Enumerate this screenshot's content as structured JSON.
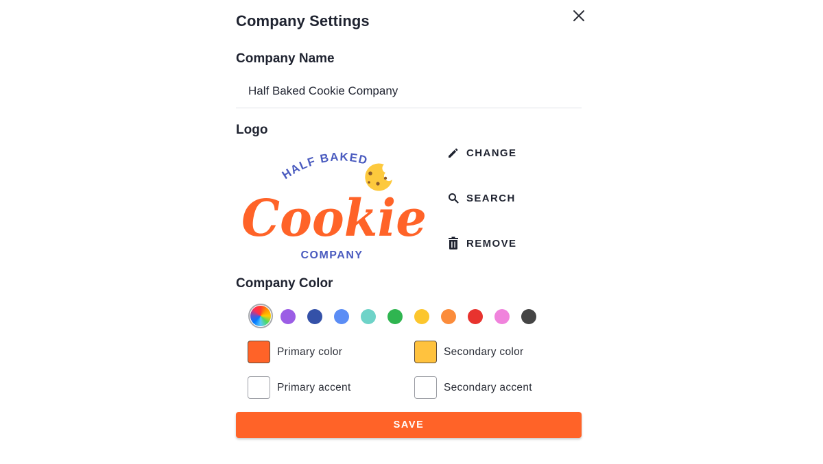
{
  "dialog": {
    "title": "Company Settings",
    "close_icon": "close-icon"
  },
  "company_name": {
    "label": "Company Name",
    "value": "Half Baked Cookie Company"
  },
  "logo": {
    "label": "Logo",
    "image": {
      "top_text": "HALF BAKED",
      "main_text": "Cookie",
      "bottom_text": "COMPANY",
      "main_color": "#ff6328",
      "text_color": "#4a5bbf",
      "cookie_color": "#fdc93d"
    },
    "actions": [
      {
        "label": "CHANGE",
        "icon": "pencil-icon"
      },
      {
        "label": "SEARCH",
        "icon": "search-icon"
      },
      {
        "label": "REMOVE",
        "icon": "trash-icon"
      }
    ]
  },
  "company_color": {
    "label": "Company Color",
    "swatches": [
      {
        "name": "custom-rainbow",
        "color": "rainbow",
        "selected": true
      },
      {
        "name": "purple",
        "color": "#9b5de5"
      },
      {
        "name": "navy",
        "color": "#3451a8"
      },
      {
        "name": "blue",
        "color": "#5b8df5"
      },
      {
        "name": "teal",
        "color": "#6ed3c8"
      },
      {
        "name": "green",
        "color": "#2fb550"
      },
      {
        "name": "yellow",
        "color": "#fcc62d"
      },
      {
        "name": "orange",
        "color": "#fb8c3b"
      },
      {
        "name": "red",
        "color": "#e8332e"
      },
      {
        "name": "pink",
        "color": "#f083dc"
      },
      {
        "name": "dark-gray",
        "color": "#454545"
      }
    ],
    "assignments": [
      {
        "label": "Primary color",
        "color": "#ff6328"
      },
      {
        "label": "Secondary color",
        "color": "#ffc23e"
      },
      {
        "label": "Primary accent",
        "color": "#ffffff"
      },
      {
        "label": "Secondary accent",
        "color": "#ffffff"
      }
    ]
  },
  "actions": {
    "save_label": "SAVE"
  }
}
